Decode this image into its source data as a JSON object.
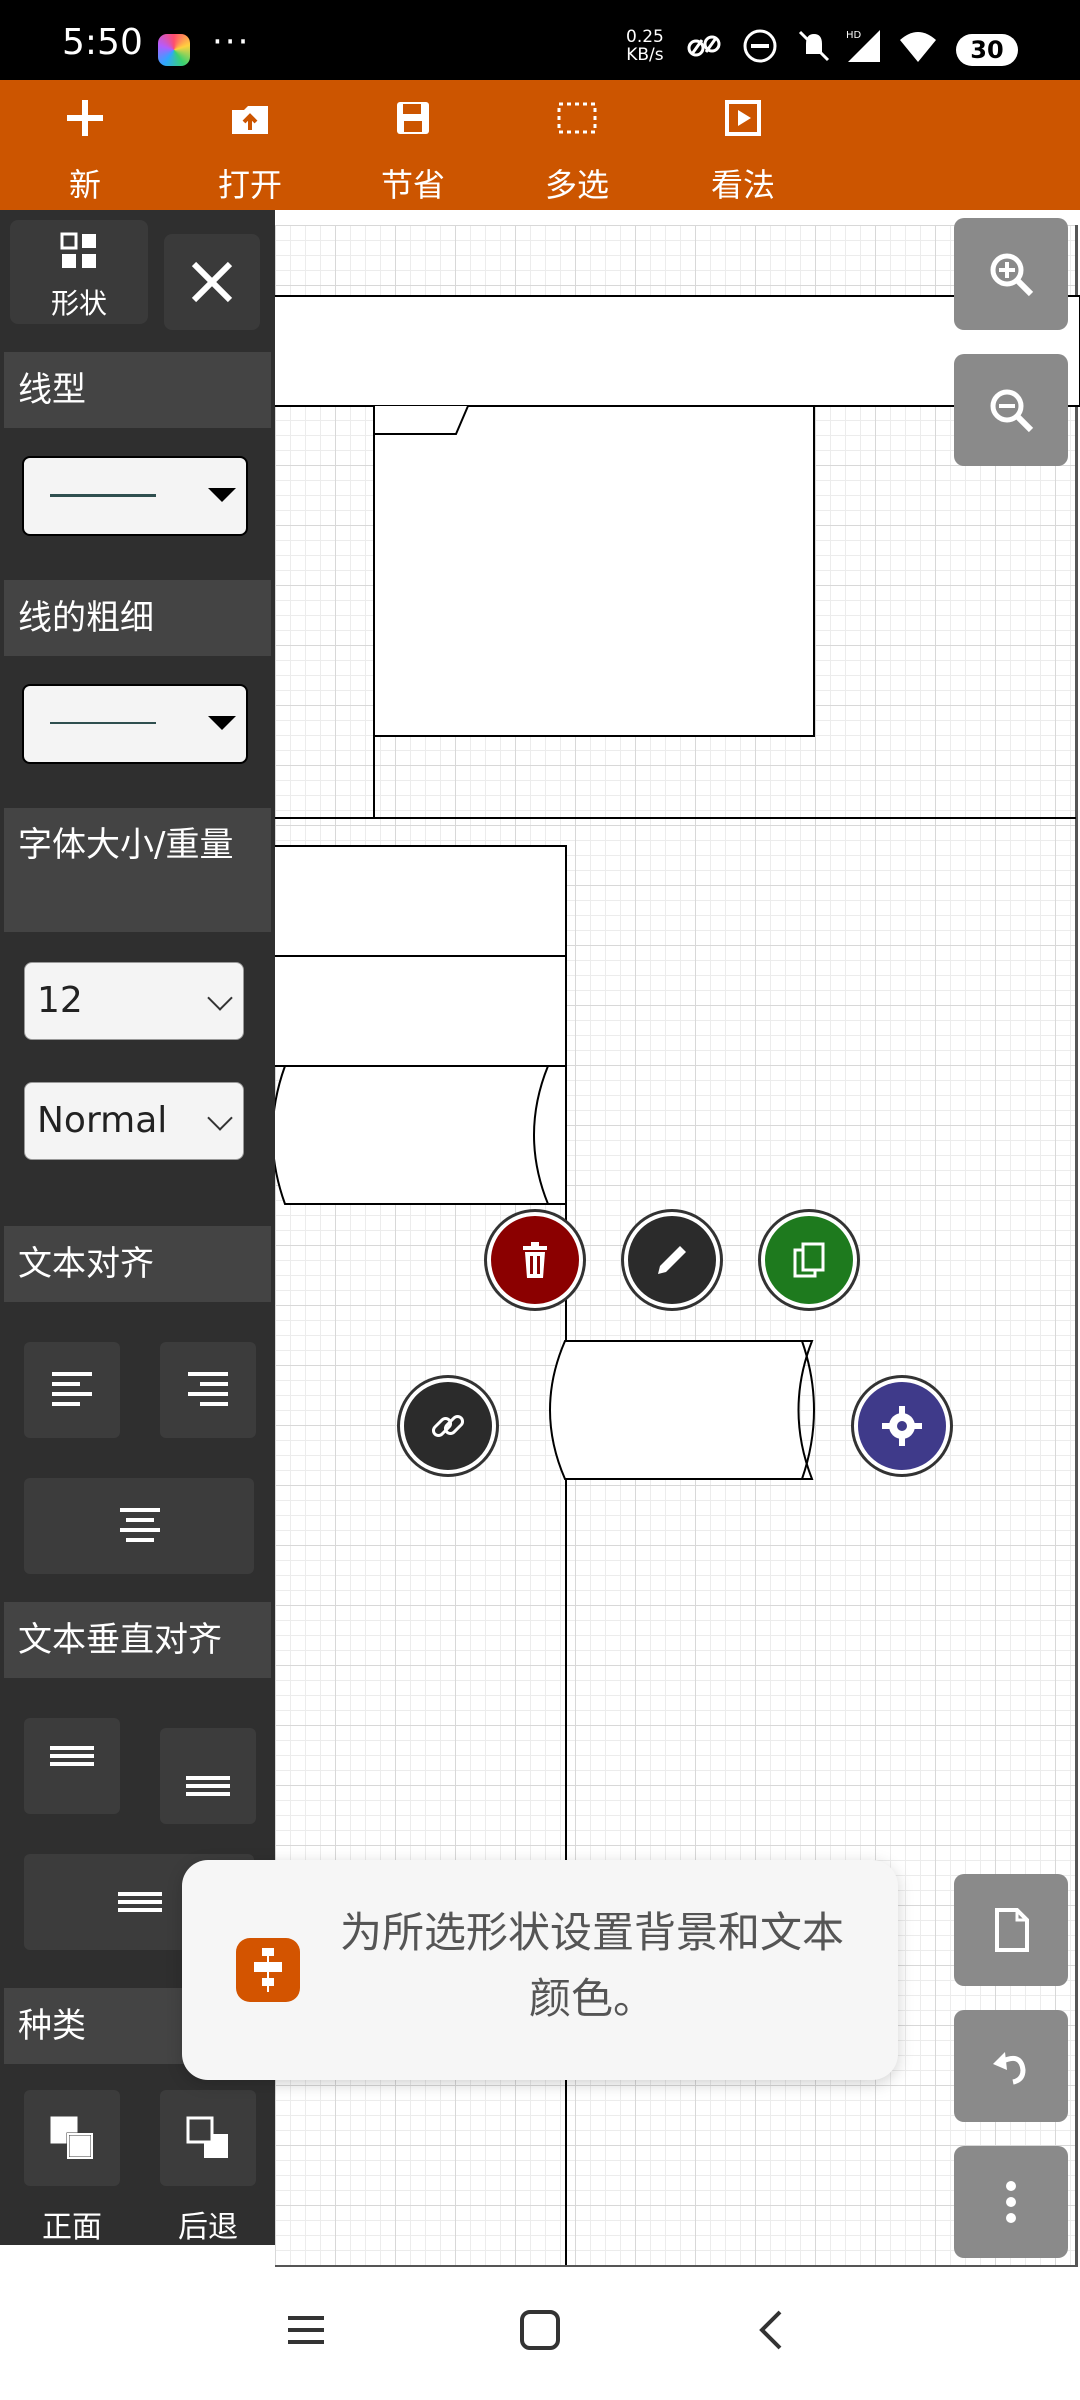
{
  "status_bar": {
    "time": "5:50",
    "more": "···",
    "speed_value": "0.25",
    "speed_unit": "KB/s",
    "hd": "HD",
    "battery": "30"
  },
  "toolbar": {
    "accent": "#cc5500",
    "items": [
      {
        "label": "新",
        "icon": "plus-icon"
      },
      {
        "label": "打开",
        "icon": "open-icon"
      },
      {
        "label": "节省",
        "icon": "save-icon"
      },
      {
        "label": "多选",
        "icon": "multi-select-icon"
      },
      {
        "label": "看法",
        "icon": "view-icon"
      }
    ]
  },
  "panel": {
    "shape_label": "形状",
    "line_type_title": "线型",
    "line_width_title": "线的粗细",
    "font_title": "字体大小/重量",
    "font_size": "12",
    "font_weight": "Normal",
    "text_align_title": "文本对齐",
    "vertical_align_title": "文本垂直对齐",
    "category_title": "种类",
    "front_label": "正面",
    "back_label": "后退"
  },
  "toast": {
    "text": "为所选形状设置背景和文本颜色。"
  },
  "colors": {
    "delete": "#8b0000",
    "edit": "#2b2b2b",
    "copy": "#1e7a1e",
    "link": "#2b2b2b",
    "settings": "#3f3a8a"
  }
}
